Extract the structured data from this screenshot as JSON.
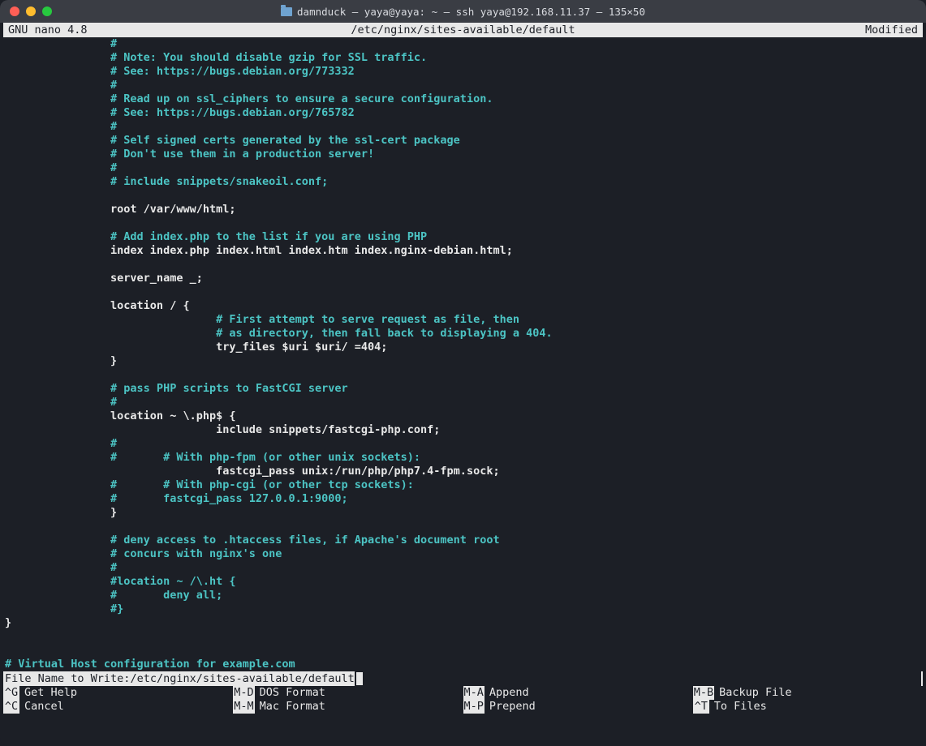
{
  "titlebar": {
    "title": "damnduck — yaya@yaya: ~ — ssh yaya@192.168.11.37 — 135×50"
  },
  "header": {
    "left": "  GNU nano 4.8",
    "center": "/etc/nginx/sites-available/default",
    "right": "Modified  "
  },
  "lines": [
    {
      "indent": 2,
      "type": "comment",
      "text": "#"
    },
    {
      "indent": 2,
      "type": "comment",
      "text": "# Note: You should disable gzip for SSL traffic."
    },
    {
      "indent": 2,
      "type": "comment",
      "text": "# See: https://bugs.debian.org/773332"
    },
    {
      "indent": 2,
      "type": "comment",
      "text": "#"
    },
    {
      "indent": 2,
      "type": "comment",
      "text": "# Read up on ssl_ciphers to ensure a secure configuration."
    },
    {
      "indent": 2,
      "type": "comment",
      "text": "# See: https://bugs.debian.org/765782"
    },
    {
      "indent": 2,
      "type": "comment",
      "text": "#"
    },
    {
      "indent": 2,
      "type": "comment",
      "text": "# Self signed certs generated by the ssl-cert package"
    },
    {
      "indent": 2,
      "type": "comment",
      "text": "# Don't use them in a production server!"
    },
    {
      "indent": 2,
      "type": "comment",
      "text": "#"
    },
    {
      "indent": 2,
      "type": "comment",
      "text": "# include snippets/snakeoil.conf;"
    },
    {
      "indent": 0,
      "type": "blank",
      "text": ""
    },
    {
      "indent": 2,
      "type": "code",
      "text": "root /var/www/html;"
    },
    {
      "indent": 0,
      "type": "blank",
      "text": ""
    },
    {
      "indent": 2,
      "type": "comment",
      "text": "# Add index.php to the list if you are using PHP"
    },
    {
      "indent": 2,
      "type": "code",
      "text": "index index.php index.html index.htm index.nginx-debian.html;"
    },
    {
      "indent": 0,
      "type": "blank",
      "text": ""
    },
    {
      "indent": 2,
      "type": "code",
      "text": "server_name _;"
    },
    {
      "indent": 0,
      "type": "blank",
      "text": ""
    },
    {
      "indent": 2,
      "type": "code",
      "text": "location / {"
    },
    {
      "indent": 4,
      "type": "comment",
      "text": "# First attempt to serve request as file, then"
    },
    {
      "indent": 4,
      "type": "comment",
      "text": "# as directory, then fall back to displaying a 404."
    },
    {
      "indent": 4,
      "type": "code",
      "text": "try_files $uri $uri/ =404;"
    },
    {
      "indent": 2,
      "type": "code",
      "text": "}"
    },
    {
      "indent": 0,
      "type": "blank",
      "text": ""
    },
    {
      "indent": 2,
      "type": "comment",
      "text": "# pass PHP scripts to FastCGI server"
    },
    {
      "indent": 2,
      "type": "comment",
      "text": "#"
    },
    {
      "indent": 2,
      "type": "code",
      "text": "location ~ \\.php$ {"
    },
    {
      "indent": 4,
      "type": "code",
      "text": "include snippets/fastcgi-php.conf;"
    },
    {
      "indent": 2,
      "type": "comment",
      "text": "#"
    },
    {
      "indent": 2,
      "type": "mixed",
      "pre": "#       ",
      "post": "# With php-fpm (or other unix sockets):"
    },
    {
      "indent": 4,
      "type": "code",
      "text": "fastcgi_pass unix:/run/php/php7.4-fpm.sock;"
    },
    {
      "indent": 2,
      "type": "mixed",
      "pre": "#       ",
      "post": "# With php-cgi (or other tcp sockets):"
    },
    {
      "indent": 2,
      "type": "comment",
      "text": "#       fastcgi_pass 127.0.0.1:9000;"
    },
    {
      "indent": 2,
      "type": "code",
      "text": "}"
    },
    {
      "indent": 0,
      "type": "blank",
      "text": ""
    },
    {
      "indent": 2,
      "type": "comment",
      "text": "# deny access to .htaccess files, if Apache's document root"
    },
    {
      "indent": 2,
      "type": "comment",
      "text": "# concurs with nginx's one"
    },
    {
      "indent": 2,
      "type": "comment",
      "text": "#"
    },
    {
      "indent": 2,
      "type": "comment",
      "text": "#location ~ /\\.ht {"
    },
    {
      "indent": 2,
      "type": "comment",
      "text": "#       deny all;"
    },
    {
      "indent": 2,
      "type": "comment",
      "text": "#}"
    },
    {
      "indent": 0,
      "type": "code",
      "text": "}"
    },
    {
      "indent": 0,
      "type": "blank",
      "text": ""
    },
    {
      "indent": 0,
      "type": "blank",
      "text": ""
    },
    {
      "indent": 0,
      "type": "comment",
      "text": "# Virtual Host configuration for example.com"
    }
  ],
  "prompt": {
    "label": "File Name to Write: ",
    "value": "/etc/nginx/sites-available/default"
  },
  "shortcuts": {
    "row1": [
      {
        "key": "^G",
        "label": "Get Help"
      },
      {
        "key": "M-D",
        "label": "DOS Format"
      },
      {
        "key": "M-A",
        "label": "Append"
      },
      {
        "key": "M-B",
        "label": "Backup File"
      }
    ],
    "row2": [
      {
        "key": "^C",
        "label": "Cancel"
      },
      {
        "key": "M-M",
        "label": "Mac Format"
      },
      {
        "key": "M-P",
        "label": "Prepend"
      },
      {
        "key": "^T",
        "label": "To Files"
      }
    ]
  }
}
